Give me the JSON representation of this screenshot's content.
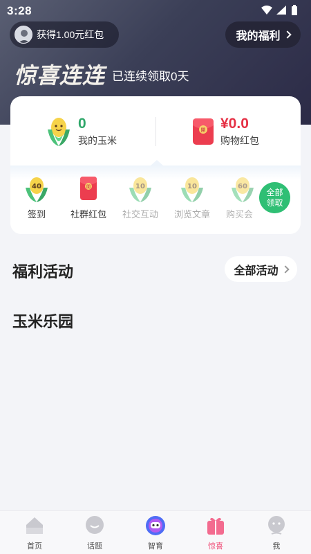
{
  "status_bar": {
    "time": "3:28"
  },
  "header": {
    "reward_pill_text": "获得1.00元红包",
    "welfare_button_label": "我的福利",
    "title": "惊喜连连",
    "streak_text": "已连续领取0天"
  },
  "summary": {
    "corn": {
      "value": "0",
      "label": "我的玉米"
    },
    "redpacket": {
      "value": "¥0.0",
      "label": "购物红包"
    }
  },
  "tasks": [
    {
      "label": "签到",
      "badge": "40"
    },
    {
      "label": "社群红包",
      "badge": "開"
    },
    {
      "label": "社交互动",
      "badge": "10"
    },
    {
      "label": "浏览文章",
      "badge": "10"
    },
    {
      "label": "购买会",
      "badge": "60"
    }
  ],
  "claim_all_label_line1": "全部",
  "claim_all_label_line2": "领取",
  "sections": {
    "welfare_activities": "福利活动",
    "all_activities_button": "全部活动",
    "corn_park": "玉米乐园"
  },
  "tabbar": [
    {
      "label": "首页"
    },
    {
      "label": "话题"
    },
    {
      "label": "智育"
    },
    {
      "label": "惊喜"
    },
    {
      "label": "我"
    }
  ],
  "colors": {
    "accent_green": "#2fbf74",
    "accent_red": "#e53145",
    "active_tab": "#f0547d"
  }
}
